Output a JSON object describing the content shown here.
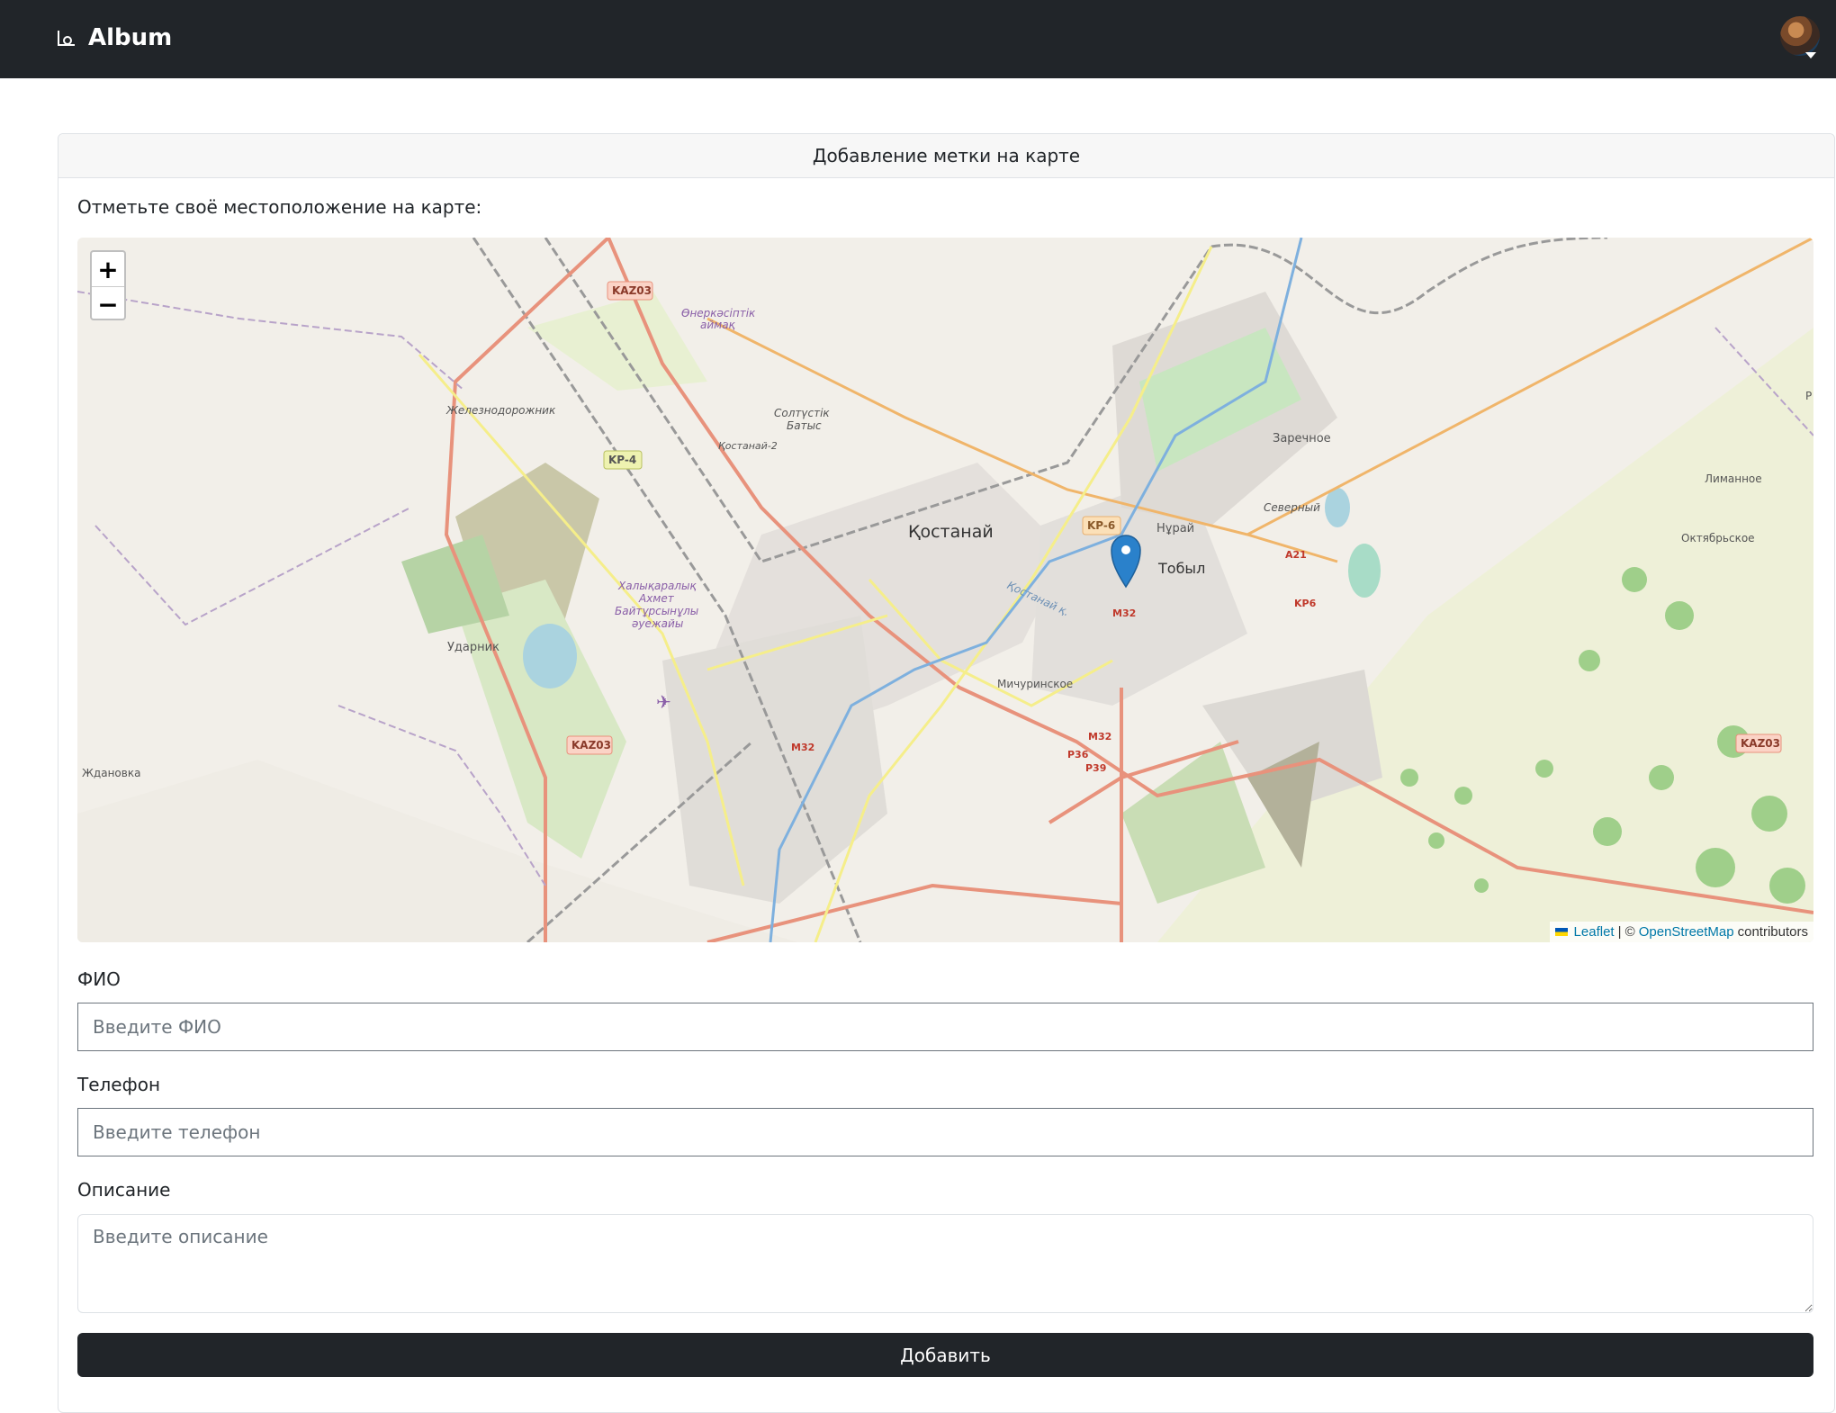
{
  "navbar": {
    "brand": "Album",
    "brand_icon": "camera-icon"
  },
  "card": {
    "header": "Добавление метки на карте"
  },
  "intro": "Отметьте своё местоположение на карте:",
  "map": {
    "zoom_in": "+",
    "zoom_out": "−",
    "places": {
      "city": "Қостанай",
      "tobyl": "Тобыл",
      "nurai": "Нұрай",
      "zarechnoe": "Заречное",
      "severny": "Северный",
      "limannoe": "Лиманное",
      "oktyabrskoe": "Октябрьское",
      "michurinskoe": "Мичуринское",
      "udarnik": "Ударник",
      "zhdanovka": "Ждановка",
      "zheleznodorozhnik": "Железнодорожник",
      "kostanai2": "Қостанай-2",
      "soltustik1": "Солтүстік",
      "soltustik2": "Батыс",
      "onerkasip1": "Өнеркәсіптік",
      "onerkasip2": "аймақ",
      "airport1": "Халықаралық",
      "airport2": "Ахмет",
      "airport3": "Байтұрсынұлы",
      "airport4": "әуежайы",
      "river": "Қостанай қ.",
      "r": "Р"
    },
    "roads": {
      "kaz03": "KAZ03",
      "kp4": "KP-4",
      "kp6": "KP-6",
      "a21": "A21",
      "kp6b": "KP6",
      "m32": "M32",
      "p36": "P36",
      "p39": "P39"
    },
    "attribution": {
      "leaflet": "Leaflet",
      "sep": "| ©",
      "osm": "OpenStreetMap",
      "contributors": "contributors"
    }
  },
  "form": {
    "name_label": "ФИО",
    "name_placeholder": "Введите ФИО",
    "phone_label": "Телефон",
    "phone_placeholder": "Введите телефон",
    "desc_label": "Описание",
    "desc_placeholder": "Введите описание",
    "submit": "Добавить"
  },
  "colors": {
    "navbar": "#212529",
    "button": "#212529",
    "link": "#0078a8",
    "marker": "#2a81cb"
  }
}
